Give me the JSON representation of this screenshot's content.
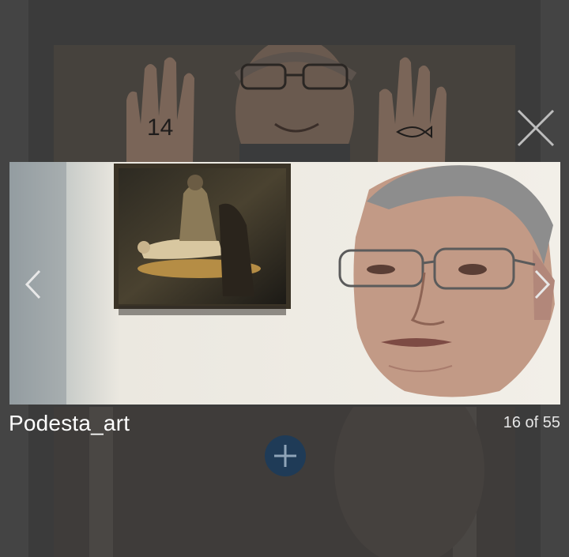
{
  "lightbox": {
    "caption": "Podesta_art",
    "counter": "16 of 55",
    "icons": {
      "close": "close-icon",
      "prev": "chevron-left-icon",
      "next": "chevron-right-icon",
      "add": "plus-icon"
    }
  },
  "background_photo": {
    "left_hand_text": "14"
  },
  "colors": {
    "overlay": "#3b3b3b",
    "add_button": "#1f3b57",
    "icon_light": "#d9d9d9"
  }
}
